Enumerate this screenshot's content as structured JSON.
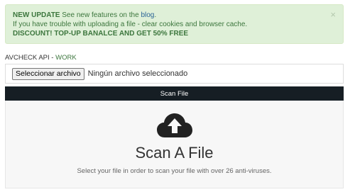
{
  "alert": {
    "new_update_label": "NEW UPDATE",
    "new_update_text": " See new features on the ",
    "blog_link": "blog",
    "period": ".",
    "upload_tip": "If you have trouble with uploading a file - clear cookies and browser cache.",
    "discount": "DISCOUNT! TOP-UP BANALCE AND GET 50% FREE",
    "close": "×"
  },
  "api": {
    "label": "AVCHECK API",
    "separator": " - ",
    "status": "WORK"
  },
  "file_input": {
    "button_label": "Seleccionar archivo",
    "status": "Ningún archivo seleccionado"
  },
  "scan_button": "Scan File",
  "drop_area": {
    "icon": "cloud-upload-icon",
    "title": "Scan A File",
    "subtitle": "Select your file in order to scan your file with over 26 anti-viruses."
  },
  "colors": {
    "alert_bg": "#dff0d8",
    "alert_text": "#3c763d",
    "link": "#2a6496",
    "scan_button_bg": "#161e24",
    "icon": "#222222"
  }
}
